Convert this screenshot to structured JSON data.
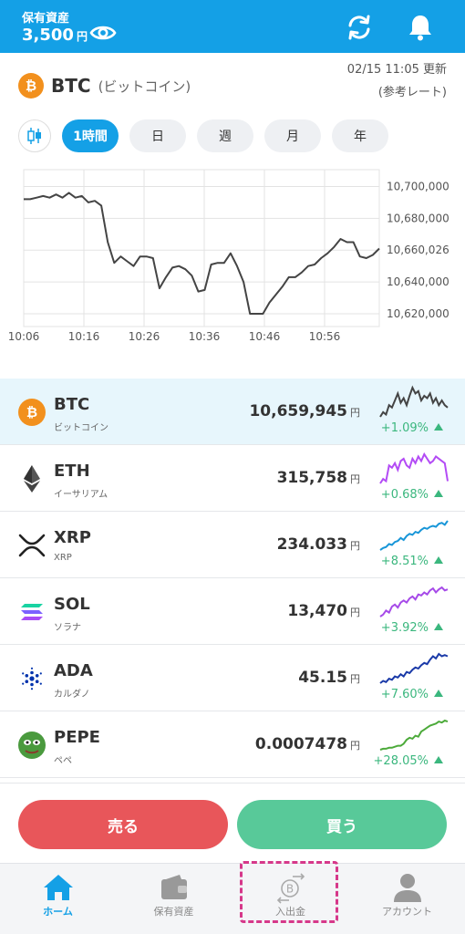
{
  "header": {
    "label": "保有資産",
    "amount": "3,500",
    "yen": "円"
  },
  "coin": {
    "symbol": "BTC",
    "name_jp": "(ビットコイン)",
    "updated_time": "02/15 11:05 更新",
    "rate_note": "(参考レート)"
  },
  "tabs": [
    {
      "label": "1時間",
      "active": true
    },
    {
      "label": "日",
      "active": false
    },
    {
      "label": "週",
      "active": false
    },
    {
      "label": "月",
      "active": false
    },
    {
      "label": "年",
      "active": false
    }
  ],
  "chart_data": {
    "type": "line",
    "x_labels": [
      "10:06",
      "10:16",
      "10:26",
      "10:36",
      "10:46",
      "10:56"
    ],
    "y_ticks": [
      10700000,
      10680000,
      10660026,
      10640000,
      10620000
    ],
    "y_tick_labels": [
      "10,700,000",
      "10,680,000",
      "10,660,026",
      "10,640,000",
      "10,620,000"
    ],
    "current_value_label": "10,660,026",
    "ylim": [
      10612000,
      10706000
    ],
    "line_color": "#444444",
    "current_color": "#14a0e6",
    "values": [
      10692000,
      10692000,
      10693000,
      10694000,
      10693000,
      10695000,
      10693000,
      10696000,
      10693000,
      10694000,
      10690000,
      10691000,
      10688000,
      10665000,
      10652000,
      10656000,
      10653000,
      10650000,
      10656000,
      10656000,
      10655000,
      10636000,
      10643000,
      10649000,
      10650000,
      10648000,
      10644000,
      10634000,
      10635000,
      10651000,
      10652000,
      10652000,
      10658000,
      10650000,
      10640000,
      10620000,
      10620000,
      10620000,
      10627000,
      10632000,
      10637000,
      10643000,
      10643000,
      10646000,
      10650000,
      10651000,
      10655000,
      10658000,
      10662000,
      10667000,
      10665000,
      10665000,
      10656000,
      10655000,
      10657000,
      10661000
    ]
  },
  "coins": [
    {
      "symbol": "BTC",
      "name": "ビットコイン",
      "price": "10,659,945",
      "yen": "円",
      "change": "+1.09%",
      "icon": "bitcoin-icon",
      "color": "#f2901d",
      "spark_color": "#444444",
      "selected": true,
      "spark": [
        10,
        14,
        12,
        20,
        18,
        24,
        30,
        22,
        26,
        20,
        28,
        35,
        30,
        32,
        24,
        28,
        26,
        30,
        22,
        26,
        20,
        24,
        20,
        18
      ]
    },
    {
      "symbol": "ETH",
      "name": "イーサリアム",
      "price": "315,758",
      "yen": "円",
      "change": "+0.68%",
      "icon": "ethereum-icon",
      "color": "#444444",
      "spark_color": "#b34bf5",
      "selected": false,
      "spark": [
        8,
        12,
        10,
        24,
        22,
        26,
        20,
        28,
        30,
        24,
        22,
        30,
        26,
        32,
        28,
        34,
        30,
        26,
        28,
        32,
        30,
        28,
        26,
        10
      ]
    },
    {
      "symbol": "XRP",
      "name": "XRP",
      "price": "234.033",
      "yen": "円",
      "change": "+8.51%",
      "icon": "xrp-icon",
      "color": "#222222",
      "spark_color": "#1896d8",
      "selected": false,
      "spark": [
        6,
        8,
        9,
        12,
        11,
        14,
        15,
        18,
        16,
        20,
        22,
        21,
        24,
        23,
        26,
        28,
        27,
        29,
        30,
        29,
        32,
        33,
        31,
        35
      ]
    },
    {
      "symbol": "SOL",
      "name": "ソラナ",
      "price": "13,470",
      "yen": "円",
      "change": "+3.92%",
      "icon": "solana-icon",
      "color": "#9945ff",
      "spark_color": "#a64ae8",
      "selected": false,
      "spark": [
        6,
        8,
        12,
        10,
        16,
        18,
        15,
        20,
        22,
        20,
        24,
        26,
        23,
        28,
        27,
        30,
        28,
        32,
        34,
        30,
        33,
        35,
        32,
        33
      ]
    },
    {
      "symbol": "ADA",
      "name": "カルダノ",
      "price": "45.15",
      "yen": "円",
      "change": "+7.60%",
      "icon": "cardano-icon",
      "color": "#0033ad",
      "spark_color": "#1a3aa8",
      "selected": false,
      "spark": [
        6,
        8,
        7,
        10,
        9,
        12,
        11,
        14,
        12,
        16,
        15,
        18,
        20,
        19,
        22,
        24,
        23,
        27,
        30,
        28,
        32,
        30,
        31,
        30
      ]
    },
    {
      "symbol": "PEPE",
      "name": "ペペ",
      "price": "0.0007478",
      "yen": "円",
      "change": "+28.05%",
      "icon": "pepe-icon",
      "color": "#3e8a3a",
      "spark_color": "#4caa3a",
      "selected": false,
      "spark": [
        4,
        5,
        5,
        6,
        6,
        7,
        8,
        8,
        10,
        14,
        16,
        15,
        18,
        17,
        22,
        24,
        26,
        28,
        29,
        30,
        32,
        31,
        33,
        32
      ]
    }
  ],
  "actions": {
    "sell": "売る",
    "buy": "買う"
  },
  "nav": [
    {
      "label": "ホーム",
      "icon": "home-icon",
      "active": true
    },
    {
      "label": "保有資産",
      "icon": "wallet-icon",
      "active": false
    },
    {
      "label": "入出金",
      "icon": "deposit-withdraw-icon",
      "active": false
    },
    {
      "label": "アカウント",
      "icon": "account-icon",
      "active": false
    }
  ],
  "colors": {
    "accent": "#14a0e6",
    "sell": "#e8565a",
    "buy": "#58c999",
    "up": "#3bb77e",
    "highlight": "#d6388a"
  }
}
